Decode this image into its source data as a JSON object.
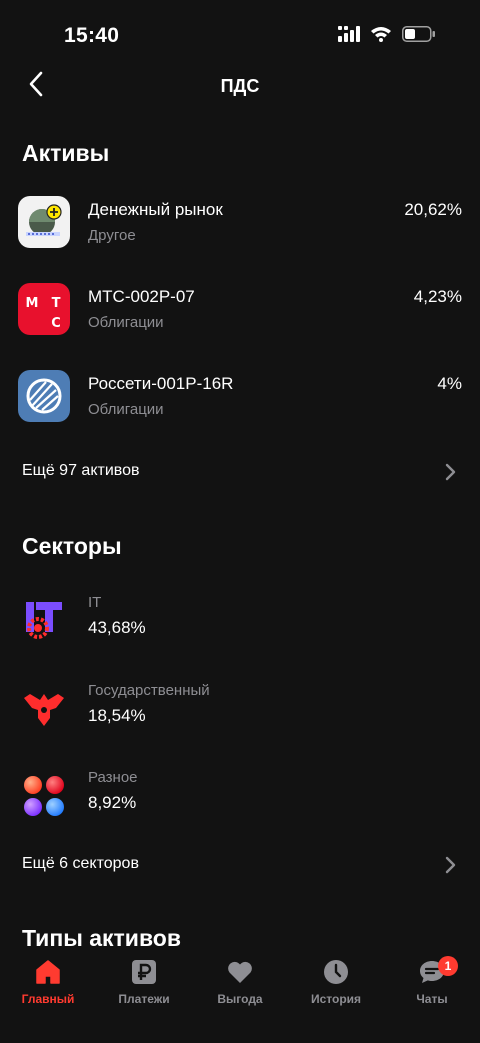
{
  "status_bar": {
    "time": "15:40"
  },
  "nav": {
    "title": "ПДС"
  },
  "assets_section": {
    "title": "Активы",
    "items": [
      {
        "name": "Денежный рынок",
        "category": "Другое",
        "percent": "20,62%",
        "logo": "money-market-icon"
      },
      {
        "name": "МТС-002Р-07",
        "category": "Облигации",
        "percent": "4,23%",
        "logo": "mts-logo"
      },
      {
        "name": "Россети-001P-16R",
        "category": "Облигации",
        "percent": "4%",
        "logo": "rosseti-logo"
      }
    ],
    "more_label": "Ещё 97 активов"
  },
  "sectors_section": {
    "title": "Секторы",
    "items": [
      {
        "name": "IT",
        "percent": "43,68%",
        "logo": "it-sector-icon"
      },
      {
        "name": "Государственный",
        "percent": "18,54%",
        "logo": "government-eagle-icon"
      },
      {
        "name": "Разное",
        "percent": "8,92%",
        "logo": "various-dots-icon"
      }
    ],
    "more_label": "Ещё 6 секторов"
  },
  "types_section": {
    "title": "Типы активов"
  },
  "tabbar": {
    "tabs": [
      {
        "label": "Главный",
        "icon": "home-icon",
        "active": true
      },
      {
        "label": "Платежи",
        "icon": "ruble-icon"
      },
      {
        "label": "Выгода",
        "icon": "heart-icon"
      },
      {
        "label": "История",
        "icon": "clock-icon"
      },
      {
        "label": "Чаты",
        "icon": "chat-icon",
        "badge": "1"
      }
    ]
  },
  "colors": {
    "accent": "#ff3b30",
    "background": "#121212",
    "secondary_text": "#8e8e93"
  }
}
